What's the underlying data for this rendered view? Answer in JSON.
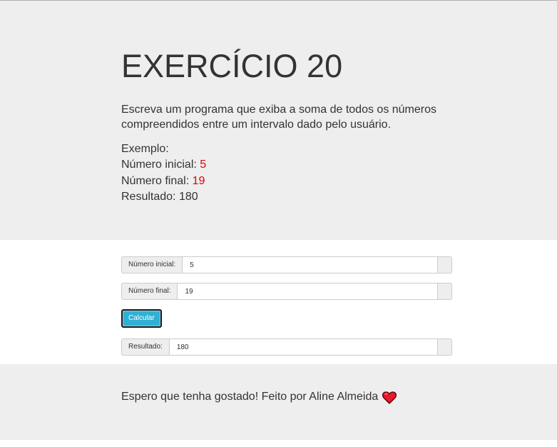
{
  "header": {
    "title": "EXERCÍCIO 20",
    "description": "Escreva um programa que exiba a soma de todos os números compreendidos entre um intervalo dado pelo usuário.",
    "example_label": "Exemplo:",
    "start_label": "Número inicial: ",
    "start_value": "5",
    "end_label": "Número final: ",
    "end_value": "19",
    "result_label": "Resultado: ",
    "result_value": "180",
    "accent_color": "#e00000"
  },
  "form": {
    "start_field": {
      "label": "Número inicial:",
      "value": "5"
    },
    "end_field": {
      "label": "Número final:",
      "value": "19"
    },
    "submit_label": "Calcular",
    "result_field": {
      "label": "Resultado:",
      "value": "180"
    },
    "button_color": "#31b0d5"
  },
  "footer": {
    "text": "Espero que tenha gostado! Feito por Aline Almeida",
    "icon": "heart-icon",
    "icon_color": "#e8192c"
  }
}
